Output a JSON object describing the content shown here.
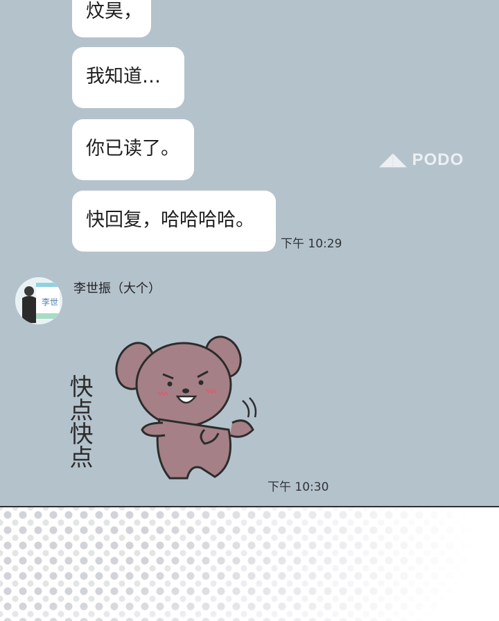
{
  "watermark": "PODO",
  "messages": [
    {
      "text": "炆昊，"
    },
    {
      "text": "我知道…"
    },
    {
      "text": "你已读了。"
    },
    {
      "text": "快回复，哈哈哈哈。",
      "time": "下午 10:29"
    }
  ],
  "incoming": {
    "sender": "李世振（大个）",
    "avatar_text": "李世",
    "sticker_text": "快点快点",
    "time": "下午 10:30"
  },
  "colors": {
    "chat_background": "#b4c2cc",
    "bubble": "#ffffff",
    "sticker_dog": "#a58086"
  }
}
